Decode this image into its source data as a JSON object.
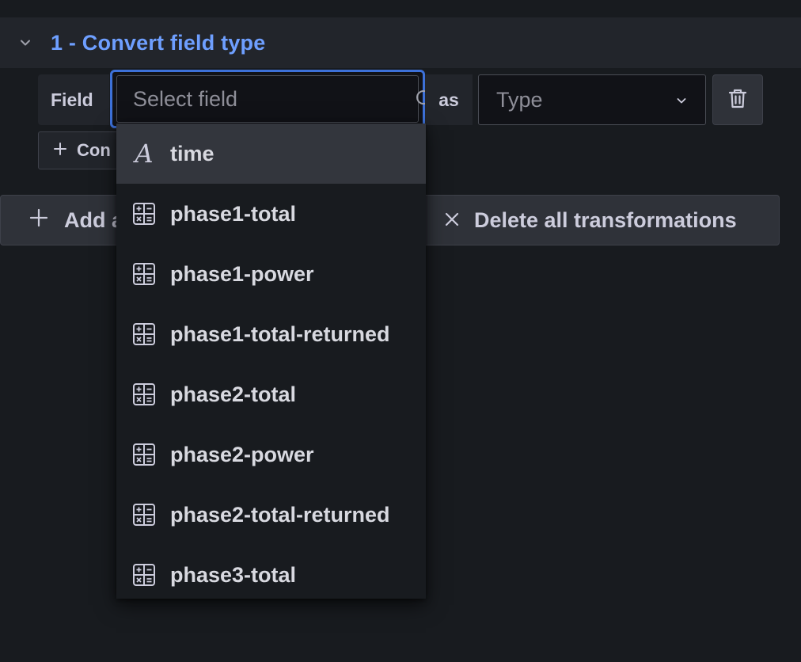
{
  "transformation": {
    "title": "1 - Convert field type"
  },
  "field_row": {
    "field_label": "Field",
    "select_placeholder": "Select field",
    "as_label": "as",
    "type_placeholder": "Type"
  },
  "add_conversion_button": "Con",
  "actions": {
    "add_another_label": "Add a",
    "delete_all_label": "Delete all transformations"
  },
  "dropdown": {
    "options": [
      {
        "label": "time",
        "icon": "string-type-icon",
        "active": true
      },
      {
        "label": "phase1-total",
        "icon": "number-type-icon"
      },
      {
        "label": "phase1-power",
        "icon": "number-type-icon"
      },
      {
        "label": "phase1-total-returned",
        "icon": "number-type-icon"
      },
      {
        "label": "phase2-total",
        "icon": "number-type-icon"
      },
      {
        "label": "phase2-power",
        "icon": "number-type-icon"
      },
      {
        "label": "phase2-total-returned",
        "icon": "number-type-icon"
      },
      {
        "label": "phase3-total",
        "icon": "number-type-icon"
      }
    ]
  },
  "colors": {
    "background": "#181b1f",
    "panel": "#22252b",
    "accent_title": "#6e9fff",
    "focus_border": "#3d71d9",
    "text": "#ccccdc"
  }
}
